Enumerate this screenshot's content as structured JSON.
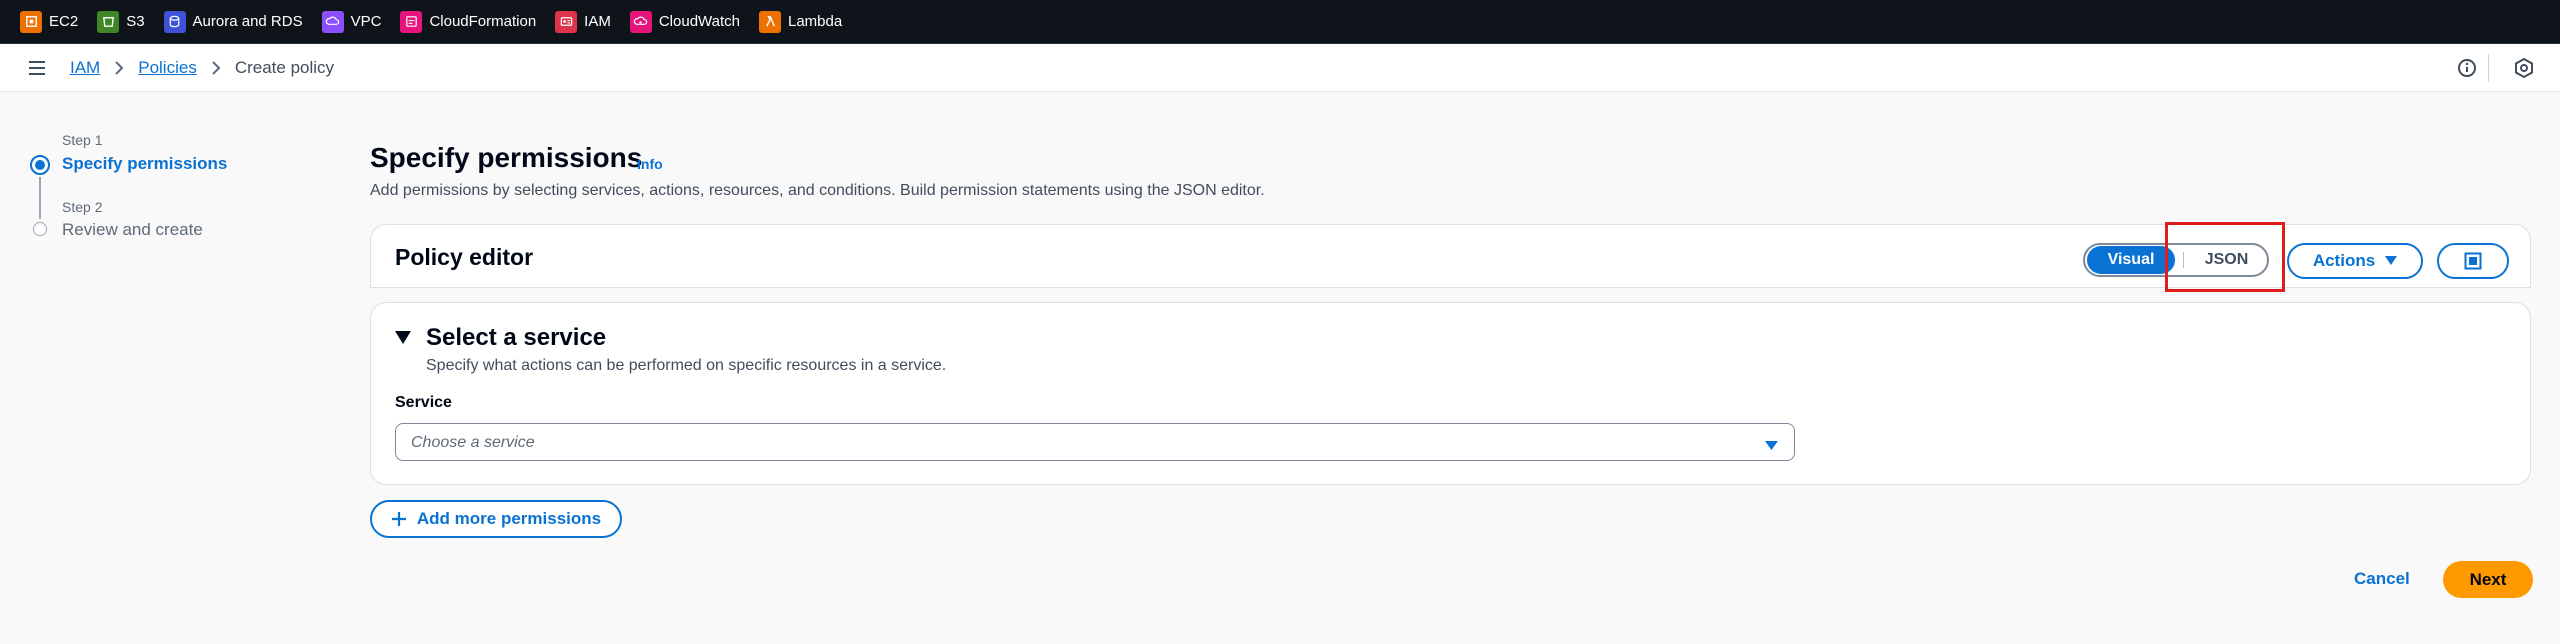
{
  "favorites": [
    {
      "label": "EC2",
      "icon": "ec2-icon",
      "color": "#ed7100"
    },
    {
      "label": "S3",
      "icon": "s3-icon",
      "color": "#3f8624"
    },
    {
      "label": "Aurora and RDS",
      "icon": "rds-icon",
      "color": "#4053d6"
    },
    {
      "label": "VPC",
      "icon": "vpc-icon",
      "color": "#8c4fff"
    },
    {
      "label": "CloudFormation",
      "icon": "cloudformation-icon",
      "color": "#e7157b"
    },
    {
      "label": "IAM",
      "icon": "iam-icon",
      "color": "#dd344c"
    },
    {
      "label": "CloudWatch",
      "icon": "cloudwatch-icon",
      "color": "#e7157b"
    },
    {
      "label": "Lambda",
      "icon": "lambda-icon",
      "color": "#ed7100"
    }
  ],
  "breadcrumb": {
    "items": [
      "IAM",
      "Policies"
    ],
    "current": "Create policy"
  },
  "steps": [
    {
      "step_label": "Step 1",
      "title": "Specify permissions",
      "active": true
    },
    {
      "step_label": "Step 2",
      "title": "Review and create",
      "active": false
    }
  ],
  "main": {
    "title": "Specify permissions",
    "info": "Info",
    "description": "Add permissions by selecting services, actions, resources, and conditions. Build permission statements using the JSON editor."
  },
  "policy_editor": {
    "title": "Policy editor",
    "mode_options": [
      "Visual",
      "JSON"
    ],
    "selected_mode": "Visual",
    "actions_label": "Actions"
  },
  "service_section": {
    "heading": "Select a service",
    "description": "Specify what actions can be performed on specific resources in a service.",
    "field_label": "Service",
    "placeholder": "Choose a service"
  },
  "add_permissions_label": "Add more permissions",
  "footer": {
    "cancel_label": "Cancel",
    "next_label": "Next"
  },
  "colors": {
    "accent": "#0972d3",
    "primary_button": "#ff9900",
    "highlight": "#e21b1b",
    "topbar": "#0f141a"
  }
}
